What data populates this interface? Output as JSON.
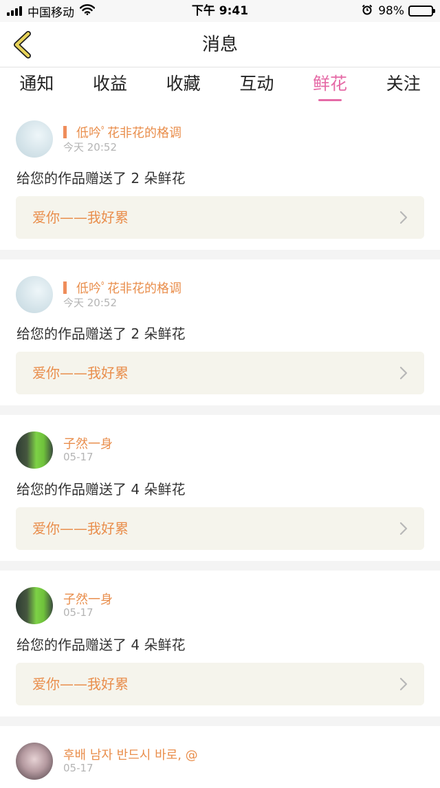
{
  "status_bar": {
    "carrier": "中国移动",
    "time": "下午 9:41",
    "battery": "98%",
    "battery_level": 0.98,
    "icons": [
      "signal-icon",
      "wifi-icon",
      "alarm-icon",
      "battery-icon"
    ]
  },
  "nav": {
    "title": "消息",
    "back_icon": "chevron-left-icon",
    "back_color": "#e7d35a"
  },
  "tabs": [
    {
      "label": "通知"
    },
    {
      "label": "收益"
    },
    {
      "label": "收藏"
    },
    {
      "label": "互动"
    },
    {
      "label": "鲜花"
    },
    {
      "label": "关注"
    }
  ],
  "active_tab": "鲜花",
  "colors": {
    "accent": "#e56aa6",
    "username": "#e98e4c",
    "work_bg": "#f5f4ec",
    "divider_bg": "#f4f4f4"
  },
  "feed": [
    {
      "name": "低吟ﾟ花非花的格调",
      "time": "今天 20:52",
      "message": "给您的作品赠送了 2 朵鲜花",
      "work": "爱你——我好累"
    },
    {
      "name": "低吟ﾟ花非花的格调",
      "time": "今天 20:52",
      "message": "给您的作品赠送了 2 朵鲜花",
      "work": "爱你——我好累"
    },
    {
      "name": "子然一身",
      "time": "05-17",
      "message": "给您的作品赠送了 4 朵鲜花",
      "work": "爱你——我好累"
    },
    {
      "name": "子然一身",
      "time": "05-17",
      "message": "给您的作品赠送了 4 朵鲜花",
      "work": "爱你——我好累"
    },
    {
      "name": "후배 남자 반드시 바로, @",
      "time": "05-17"
    }
  ]
}
